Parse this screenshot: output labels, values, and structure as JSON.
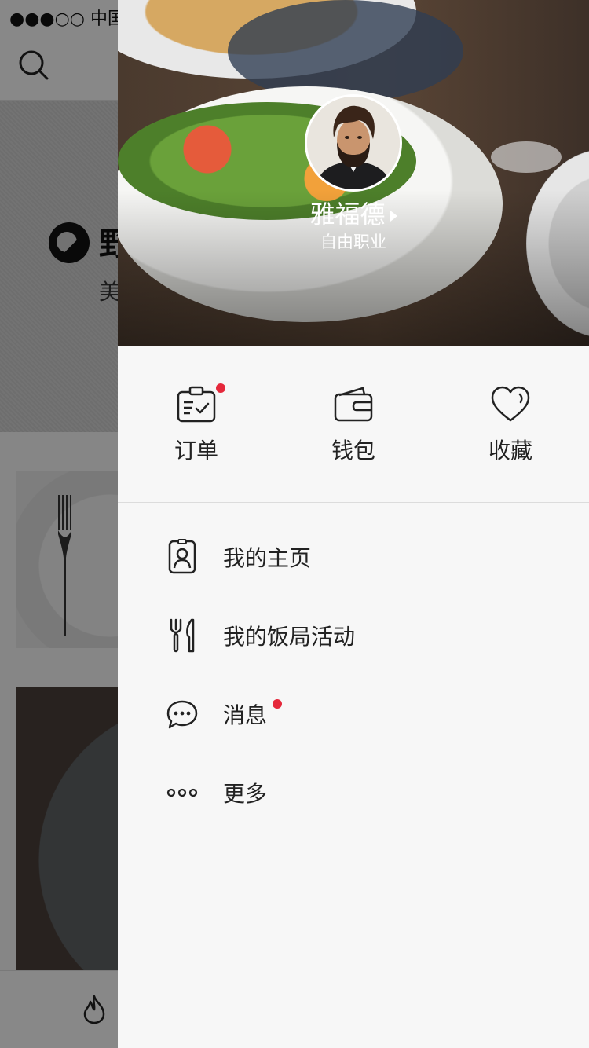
{
  "status_bar": {
    "carrier_text": "●●●○○ 中国联"
  },
  "background_page": {
    "hero_title": "野",
    "hero_subtitle": "美"
  },
  "drawer": {
    "user": {
      "name": "雅福德",
      "occupation": "自由职业"
    },
    "quick_actions": [
      {
        "label": "订单",
        "icon": "order-clipboard-icon",
        "has_badge": true
      },
      {
        "label": "钱包",
        "icon": "wallet-icon",
        "has_badge": false
      },
      {
        "label": "收藏",
        "icon": "heart-icon",
        "has_badge": false
      }
    ],
    "menu": [
      {
        "label": "我的主页",
        "icon": "profile-card-icon",
        "has_badge": false
      },
      {
        "label": "我的饭局活动",
        "icon": "fork-knife-icon",
        "has_badge": false
      },
      {
        "label": "消息",
        "icon": "chat-bubble-icon",
        "has_badge": true
      },
      {
        "label": "更多",
        "icon": "more-dots-icon",
        "has_badge": false
      }
    ]
  },
  "colors": {
    "badge": "#e5283b",
    "drawer_bg": "#f7f7f7",
    "text": "#222222"
  }
}
